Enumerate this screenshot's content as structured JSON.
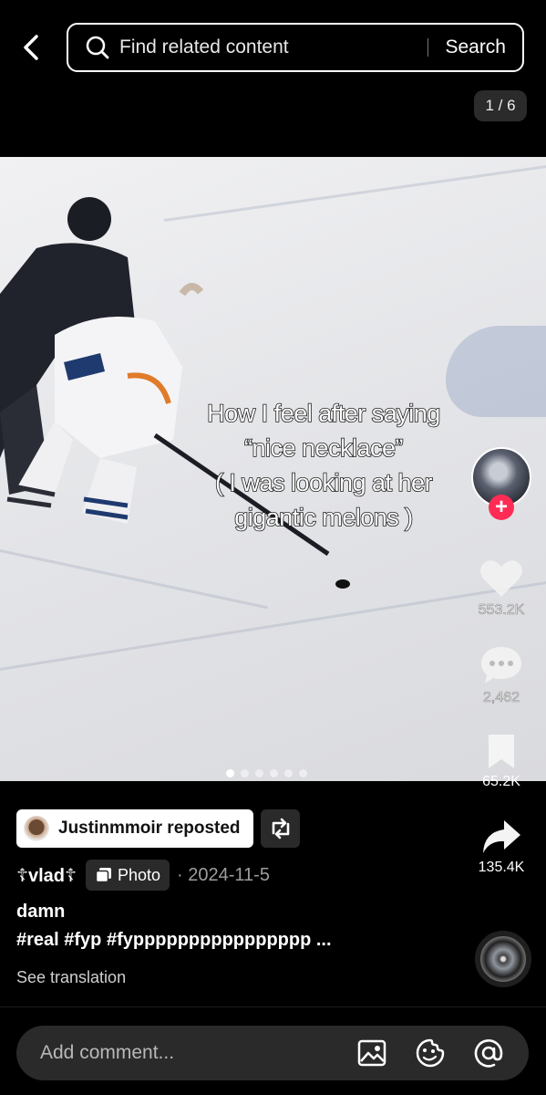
{
  "search": {
    "placeholder": "Find related content",
    "button_label": "Search"
  },
  "pager": {
    "counter": "1 / 6",
    "total_dots": 6,
    "active_index": 0
  },
  "post": {
    "caption_lines": [
      "How I feel after saying",
      "“nice necklace”",
      "( I was looking at her",
      "gigantic melons )"
    ],
    "repost_label": "Justinmmoir reposted",
    "author": "☦vlad☦",
    "type_badge": "Photo",
    "date": "· 2024-11-5",
    "title": "damn",
    "hashtags": "#real #fyp #fypppppppppppppppp ...",
    "translate_label": "See translation"
  },
  "actions": {
    "likes": "553.2K",
    "comments": "2,462",
    "saves": "65.2K",
    "shares": "135.4K"
  },
  "comment_bar": {
    "placeholder": "Add comment..."
  },
  "colors": {
    "background": "#000000",
    "accent": "#fe2c55",
    "surface": "#2a2a2a"
  },
  "icons": [
    "back-chevron-icon",
    "search-icon",
    "heart-icon",
    "comment-icon",
    "bookmark-icon",
    "share-icon",
    "repost-icon",
    "photo-icon",
    "image-icon",
    "emoji-icon",
    "mention-icon"
  ]
}
